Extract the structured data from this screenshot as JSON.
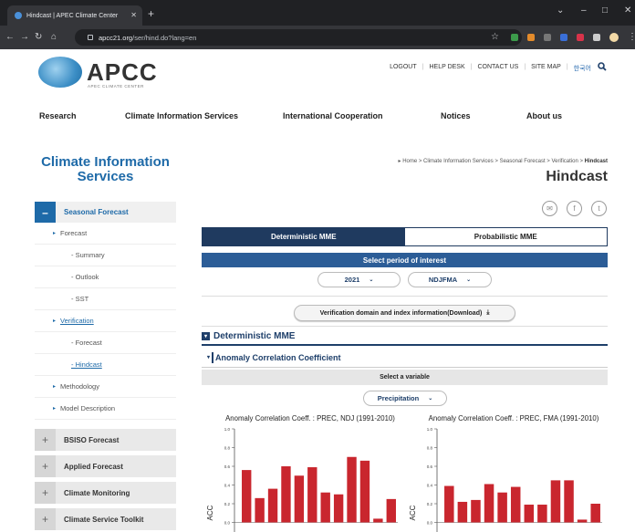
{
  "browser": {
    "tab_title": "Hindcast | APEC Climate Center",
    "url_host": "apcc21.org",
    "url_path": "/ser/hind.do?lang=en"
  },
  "header": {
    "logo_text": "APCC",
    "logo_sub": "APEC CLIMATE CENTER",
    "links": [
      "LOGOUT",
      "HELP DESK",
      "CONTACT US",
      "SITE MAP",
      "한국어"
    ]
  },
  "mainnav": [
    "Research",
    "Climate Information Services",
    "International Cooperation",
    "Notices",
    "About us"
  ],
  "sidebar": {
    "title": "Climate Information Services",
    "active_section": "Seasonal Forecast",
    "items": [
      {
        "label": "Forecast",
        "level": 1
      },
      {
        "label": "- Summary",
        "level": 2
      },
      {
        "label": "- Outlook",
        "level": 2
      },
      {
        "label": "- SST",
        "level": 2
      },
      {
        "label": "Verification",
        "level": 1
      },
      {
        "label": "- Forecast",
        "level": 2
      },
      {
        "label": "- Hindcast",
        "level": 2
      },
      {
        "label": "Methodology",
        "level": 1
      },
      {
        "label": "Model Description",
        "level": 1
      }
    ],
    "sections": [
      "BSISO Forecast",
      "Applied Forecast",
      "Climate Monitoring",
      "Climate Service Toolkit"
    ]
  },
  "content": {
    "breadcrumb": "Home > Climate Information Services > Seasonal Forecast > Verification >",
    "breadcrumb_current": "Hindcast",
    "title": "Hindcast",
    "tab_deterministic": "Deterministic MME",
    "tab_probabilistic": "Probabilistic MME",
    "period_label": "Select period of interest",
    "year_value": "2021",
    "season_value": "NDJFMA",
    "download_label": "Verification domain and index information(Download)",
    "section_title": "Deterministic MME",
    "accordion_label": "Anomaly Correlation Coefficient",
    "variable_label": "Select a variable",
    "variable_value": "Precipitation"
  },
  "chart_data": [
    {
      "type": "bar",
      "title": "Anomaly Correlation Coeff. : PREC, NDJ (1991-2010)",
      "ylabel": "ACC",
      "ylim": [
        -0.2,
        1.0
      ],
      "yticks": [
        "1.0",
        "0.8",
        "0.6",
        "0.4",
        "0.2",
        "0.0",
        "-0.2"
      ],
      "values": [
        0.56,
        0.26,
        0.36,
        0.6,
        0.5,
        0.59,
        0.32,
        0.3,
        0.7,
        0.66,
        0.04,
        0.25
      ],
      "color": "#c9262e"
    },
    {
      "type": "bar",
      "title": "Anomaly Correlation Coeff. : PREC, FMA (1991-2010)",
      "ylabel": "ACC",
      "ylim": [
        -0.2,
        1.0
      ],
      "yticks": [
        "1.0",
        "0.8",
        "0.6",
        "0.4",
        "0.2",
        "0.0",
        "-0.2"
      ],
      "values": [
        0.39,
        0.22,
        0.24,
        0.41,
        0.32,
        0.38,
        0.19,
        0.19,
        0.45,
        0.45,
        0.03,
        0.2
      ],
      "color": "#c9262e"
    }
  ]
}
